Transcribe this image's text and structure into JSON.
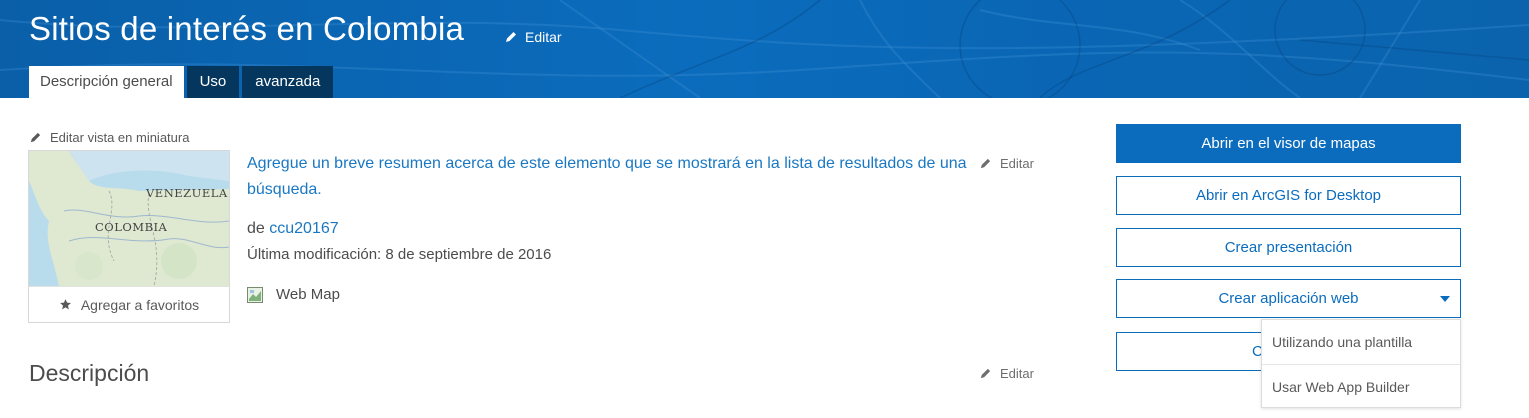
{
  "header": {
    "title": "Sitios de interés en Colombia",
    "edit_label": "Editar",
    "tabs": [
      {
        "label": "Descripción general",
        "active": true
      },
      {
        "label": "Uso",
        "active": false
      },
      {
        "label": "avanzada",
        "active": false
      }
    ],
    "bg_color": "#0b6cbd"
  },
  "thumbnail": {
    "edit_label": "Editar vista en miniatura",
    "map_labels": {
      "country1": "VENEZUELA",
      "country2": "COLOMBIA"
    },
    "favorite_label": "Agregar a favoritos",
    "favorite_icon": "star-icon"
  },
  "summary": {
    "text": "Agregue un breve resumen acerca de este elemento que se mostrará en la lista de resultados de una búsqueda.",
    "edit_label": "Editar"
  },
  "meta": {
    "owner_prefix": "de",
    "owner": "ccu20167",
    "modified": "Última modificación: 8 de septiembre de 2016",
    "item_type": "Web Map",
    "item_type_icon": "web-map-icon"
  },
  "description": {
    "heading": "Descripción",
    "edit_label": "Editar"
  },
  "actions": {
    "open_map_viewer": "Abrir en el visor de mapas",
    "open_desktop": "Abrir en ArcGIS for Desktop",
    "create_presentation": "Crear presentación",
    "create_web_app": "Crear aplicación web",
    "hidden_button_partial": "C",
    "dropdown": [
      "Utilizando una plantilla",
      "Usar Web App Builder"
    ],
    "accent_color": "#0b6cbd"
  }
}
